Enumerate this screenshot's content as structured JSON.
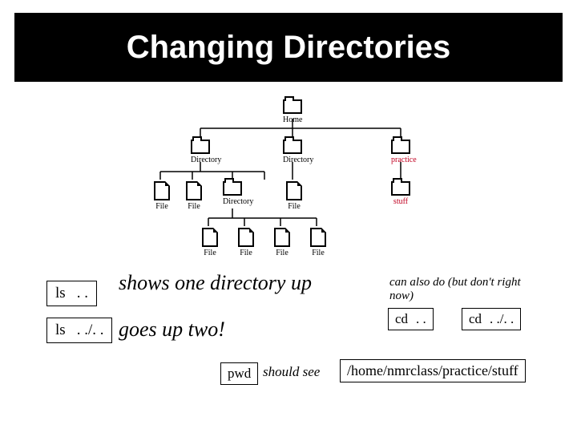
{
  "title": "Changing Directories",
  "tree": {
    "home": "Home",
    "dir1": "Directory",
    "dir2": "Directory",
    "practice": "practice",
    "l2_file1": "File",
    "l2_file2": "File",
    "l2_dir": "Directory",
    "l2_file3": "File",
    "stuff": "stuff",
    "l3_file1": "File",
    "l3_file2": "File",
    "l3_file3": "File",
    "l3_file4": "File"
  },
  "commands": {
    "ls_up": {
      "cmd": "ls",
      "arg": ". ."
    },
    "ls_up2": {
      "cmd": "ls",
      "arg": ". ./. ."
    },
    "cd_up": {
      "cmd": "cd",
      "arg": ". ."
    },
    "cd_up2": {
      "cmd": "cd",
      "arg": ". ./. ."
    },
    "pwd": {
      "cmd": "pwd"
    }
  },
  "descriptions": {
    "one_up": "shows one directory up",
    "two_up": "goes up two!",
    "note": "can also do (but don't right now)",
    "should_see": "should see",
    "path": "/home/nmrclass/practice/stuff"
  }
}
